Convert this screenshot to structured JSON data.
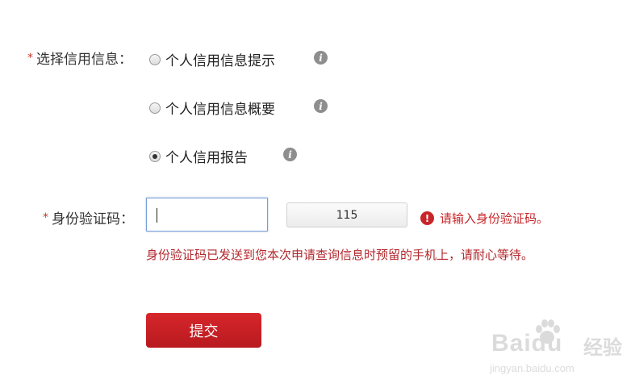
{
  "credit_info": {
    "required_mark": "*",
    "label": "选择信用信息：",
    "options": [
      {
        "label": "个人信用信息提示",
        "selected": false,
        "info_icon": "info-icon"
      },
      {
        "label": "个人信用信息概要",
        "selected": false,
        "info_icon": "info-icon"
      },
      {
        "label": "个人信用报告",
        "selected": true,
        "info_icon": "info-icon"
      }
    ]
  },
  "verification": {
    "required_mark": "*",
    "label": "身份验证码：",
    "input_value": "",
    "countdown_label": "115",
    "error_icon": "exclamation-icon",
    "error_text": "请输入身份验证码。",
    "hint_text": "身份验证码已发送到您本次申请查询信息时预留的手机上，请耐心等待。"
  },
  "submit_label": "提交",
  "watermark": {
    "main": "Baidu",
    "sub": "经验",
    "url": "jingyan.baidu.com"
  },
  "colors": {
    "required": "#c0392b",
    "error": "#c8262a",
    "hint": "#b3282d",
    "submit_bg": "#c8262a",
    "input_border": "#7a9ed8",
    "info_icon_bg": "#8e8e8e"
  }
}
